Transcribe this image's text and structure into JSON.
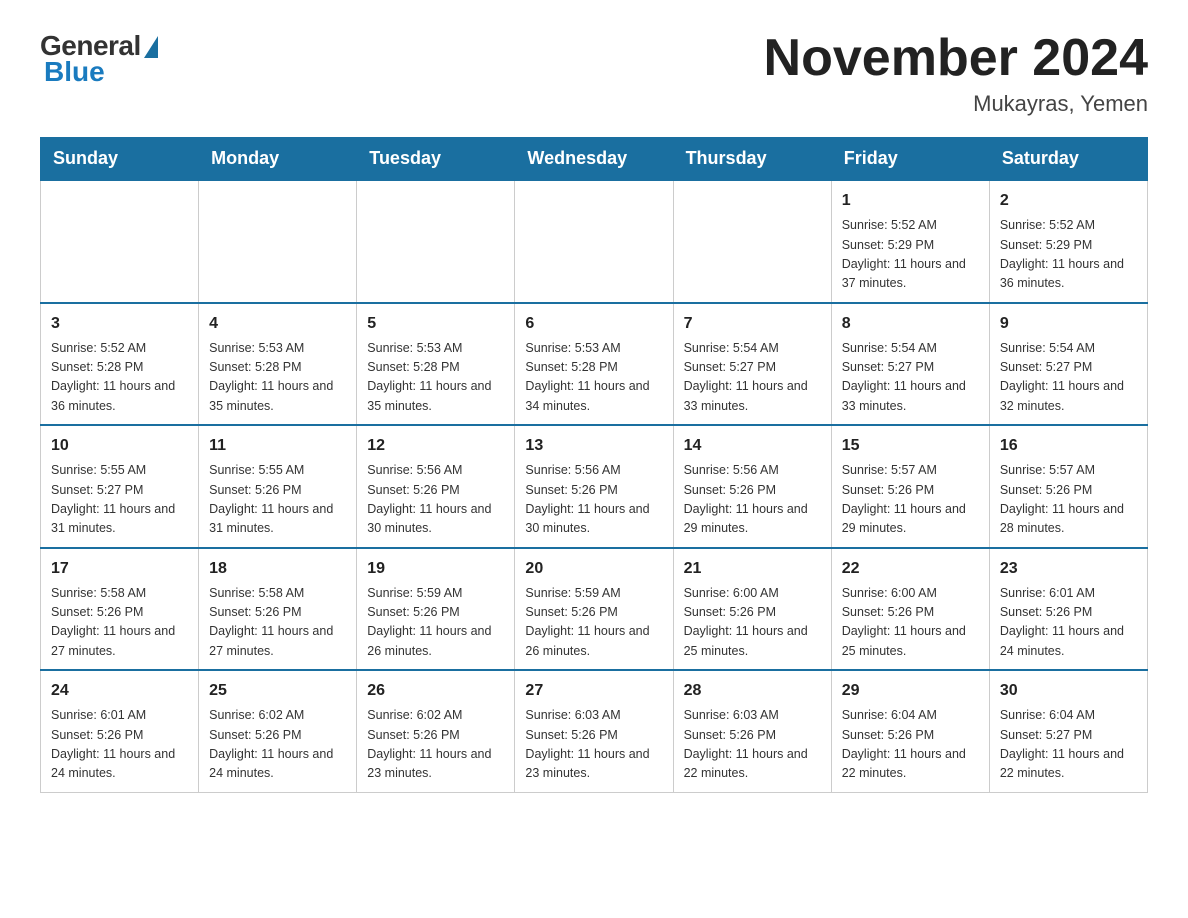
{
  "header": {
    "logo": {
      "general": "General",
      "blue": "Blue"
    },
    "title": "November 2024",
    "location": "Mukayras, Yemen"
  },
  "days_of_week": [
    "Sunday",
    "Monday",
    "Tuesday",
    "Wednesday",
    "Thursday",
    "Friday",
    "Saturday"
  ],
  "weeks": [
    [
      {
        "day": "",
        "info": ""
      },
      {
        "day": "",
        "info": ""
      },
      {
        "day": "",
        "info": ""
      },
      {
        "day": "",
        "info": ""
      },
      {
        "day": "",
        "info": ""
      },
      {
        "day": "1",
        "info": "Sunrise: 5:52 AM\nSunset: 5:29 PM\nDaylight: 11 hours and 37 minutes."
      },
      {
        "day": "2",
        "info": "Sunrise: 5:52 AM\nSunset: 5:29 PM\nDaylight: 11 hours and 36 minutes."
      }
    ],
    [
      {
        "day": "3",
        "info": "Sunrise: 5:52 AM\nSunset: 5:28 PM\nDaylight: 11 hours and 36 minutes."
      },
      {
        "day": "4",
        "info": "Sunrise: 5:53 AM\nSunset: 5:28 PM\nDaylight: 11 hours and 35 minutes."
      },
      {
        "day": "5",
        "info": "Sunrise: 5:53 AM\nSunset: 5:28 PM\nDaylight: 11 hours and 35 minutes."
      },
      {
        "day": "6",
        "info": "Sunrise: 5:53 AM\nSunset: 5:28 PM\nDaylight: 11 hours and 34 minutes."
      },
      {
        "day": "7",
        "info": "Sunrise: 5:54 AM\nSunset: 5:27 PM\nDaylight: 11 hours and 33 minutes."
      },
      {
        "day": "8",
        "info": "Sunrise: 5:54 AM\nSunset: 5:27 PM\nDaylight: 11 hours and 33 minutes."
      },
      {
        "day": "9",
        "info": "Sunrise: 5:54 AM\nSunset: 5:27 PM\nDaylight: 11 hours and 32 minutes."
      }
    ],
    [
      {
        "day": "10",
        "info": "Sunrise: 5:55 AM\nSunset: 5:27 PM\nDaylight: 11 hours and 31 minutes."
      },
      {
        "day": "11",
        "info": "Sunrise: 5:55 AM\nSunset: 5:26 PM\nDaylight: 11 hours and 31 minutes."
      },
      {
        "day": "12",
        "info": "Sunrise: 5:56 AM\nSunset: 5:26 PM\nDaylight: 11 hours and 30 minutes."
      },
      {
        "day": "13",
        "info": "Sunrise: 5:56 AM\nSunset: 5:26 PM\nDaylight: 11 hours and 30 minutes."
      },
      {
        "day": "14",
        "info": "Sunrise: 5:56 AM\nSunset: 5:26 PM\nDaylight: 11 hours and 29 minutes."
      },
      {
        "day": "15",
        "info": "Sunrise: 5:57 AM\nSunset: 5:26 PM\nDaylight: 11 hours and 29 minutes."
      },
      {
        "day": "16",
        "info": "Sunrise: 5:57 AM\nSunset: 5:26 PM\nDaylight: 11 hours and 28 minutes."
      }
    ],
    [
      {
        "day": "17",
        "info": "Sunrise: 5:58 AM\nSunset: 5:26 PM\nDaylight: 11 hours and 27 minutes."
      },
      {
        "day": "18",
        "info": "Sunrise: 5:58 AM\nSunset: 5:26 PM\nDaylight: 11 hours and 27 minutes."
      },
      {
        "day": "19",
        "info": "Sunrise: 5:59 AM\nSunset: 5:26 PM\nDaylight: 11 hours and 26 minutes."
      },
      {
        "day": "20",
        "info": "Sunrise: 5:59 AM\nSunset: 5:26 PM\nDaylight: 11 hours and 26 minutes."
      },
      {
        "day": "21",
        "info": "Sunrise: 6:00 AM\nSunset: 5:26 PM\nDaylight: 11 hours and 25 minutes."
      },
      {
        "day": "22",
        "info": "Sunrise: 6:00 AM\nSunset: 5:26 PM\nDaylight: 11 hours and 25 minutes."
      },
      {
        "day": "23",
        "info": "Sunrise: 6:01 AM\nSunset: 5:26 PM\nDaylight: 11 hours and 24 minutes."
      }
    ],
    [
      {
        "day": "24",
        "info": "Sunrise: 6:01 AM\nSunset: 5:26 PM\nDaylight: 11 hours and 24 minutes."
      },
      {
        "day": "25",
        "info": "Sunrise: 6:02 AM\nSunset: 5:26 PM\nDaylight: 11 hours and 24 minutes."
      },
      {
        "day": "26",
        "info": "Sunrise: 6:02 AM\nSunset: 5:26 PM\nDaylight: 11 hours and 23 minutes."
      },
      {
        "day": "27",
        "info": "Sunrise: 6:03 AM\nSunset: 5:26 PM\nDaylight: 11 hours and 23 minutes."
      },
      {
        "day": "28",
        "info": "Sunrise: 6:03 AM\nSunset: 5:26 PM\nDaylight: 11 hours and 22 minutes."
      },
      {
        "day": "29",
        "info": "Sunrise: 6:04 AM\nSunset: 5:26 PM\nDaylight: 11 hours and 22 minutes."
      },
      {
        "day": "30",
        "info": "Sunrise: 6:04 AM\nSunset: 5:27 PM\nDaylight: 11 hours and 22 minutes."
      }
    ]
  ]
}
